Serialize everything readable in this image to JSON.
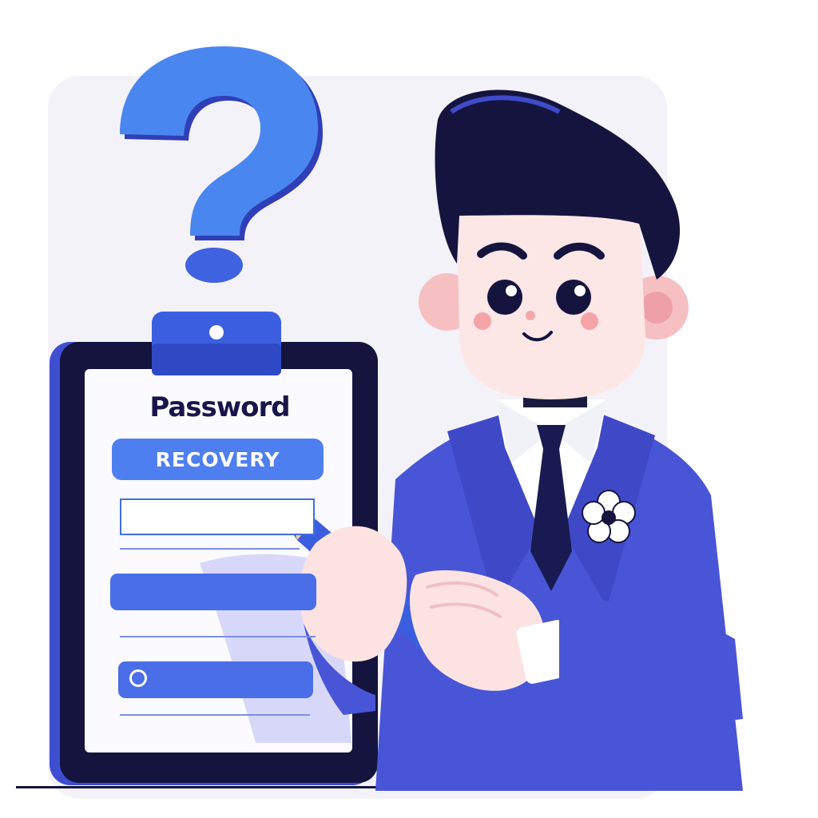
{
  "form": {
    "title": "Password",
    "badge": "RECOVERY"
  },
  "colors": {
    "accent": "#4e7ff0",
    "suit": "#4855d6",
    "dark_navy": "#14143f",
    "question_mark": "#3f6ee0",
    "background_panel": "#f3f2f8"
  },
  "icons": {
    "question_mark": "question-mark-icon",
    "radio": "radio-button-icon",
    "flower": "flower-icon",
    "pencil": "pencil-icon"
  }
}
